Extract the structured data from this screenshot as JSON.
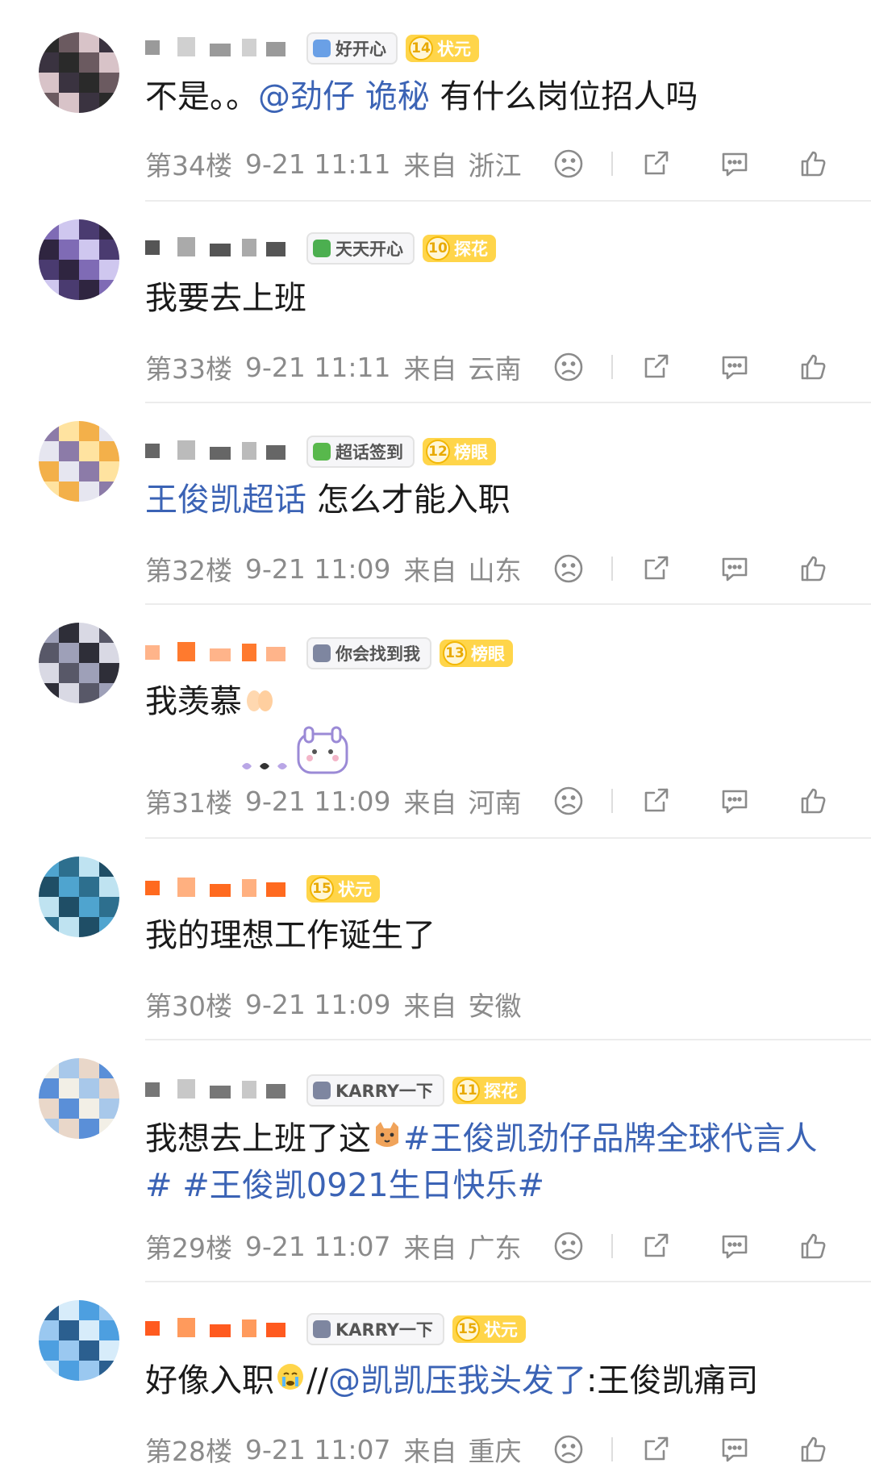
{
  "comments": [
    {
      "badge": "好开心",
      "badge_color": "#6aa0e6",
      "level_num": "14",
      "level_text": "状元",
      "content_parts": [
        {
          "t": "不是。。",
          "link": false
        },
        {
          "t": "@劲仔",
          "link": true
        },
        {
          "t": " ",
          "link": false
        },
        {
          "t": "诡秘",
          "link": true
        },
        {
          "t": " 有什么岗位招人吗",
          "link": false
        }
      ],
      "floor": "第34楼",
      "time": "9-21 11:11",
      "from": "来自",
      "region": "浙江"
    },
    {
      "badge": "天天开心",
      "badge_color": "#4caf50",
      "level_num": "10",
      "level_text": "探花",
      "content_parts": [
        {
          "t": "我要去上班",
          "link": false
        }
      ],
      "floor": "第33楼",
      "time": "9-21 11:11",
      "from": "来自",
      "region": "云南"
    },
    {
      "badge": "超话签到",
      "badge_color": "#58b84c",
      "level_num": "12",
      "level_text": "榜眼",
      "content_parts": [
        {
          "t": "王俊凯超话",
          "link": true
        },
        {
          "t": " 怎么才能入职",
          "link": false
        }
      ],
      "floor": "第32楼",
      "time": "9-21 11:09",
      "from": "来自",
      "region": "山东"
    },
    {
      "badge": "你会找到我",
      "badge_color": "#7e86a0",
      "level_num": "13",
      "level_text": "榜眼",
      "content_parts": [
        {
          "t": "我羡慕",
          "link": false
        }
      ],
      "floor": "第31楼",
      "time": "9-21 11:09",
      "from": "来自",
      "region": "河南"
    },
    {
      "badge": "",
      "badge_color": "",
      "level_num": "15",
      "level_text": "状元",
      "content_parts": [
        {
          "t": "我的理想工作诞生了",
          "link": false
        }
      ],
      "floor": "第30楼",
      "time": "9-21 11:09",
      "from": "来自",
      "region": "安徽"
    },
    {
      "badge": "KARRY一下",
      "badge_color": "#7e86a0",
      "level_num": "11",
      "level_text": "探花",
      "content_parts": [
        {
          "t": "我想去上班了这",
          "link": false
        },
        {
          "t": "#王俊凯劲仔品牌全球代言人#",
          "link": true
        },
        {
          "t": " ",
          "link": false
        },
        {
          "t": "#王俊凯0921生日快乐#",
          "link": true
        }
      ],
      "floor": "第29楼",
      "time": "9-21 11:07",
      "from": "来自",
      "region": "广东"
    },
    {
      "badge": "KARRY一下",
      "badge_color": "#7e86a0",
      "level_num": "15",
      "level_text": "状元",
      "content_parts": [
        {
          "t": "好像入职",
          "link": false
        },
        {
          "t": "//",
          "link": false
        },
        {
          "t": "@凯凯压我头发了",
          "link": true
        },
        {
          "t": ":王俊凯痛司",
          "link": false
        }
      ],
      "floor": "第28楼",
      "time": "9-21 11:07",
      "from": "来自",
      "region": "重庆"
    }
  ],
  "colors": {
    "link": "#3b63b5",
    "meta": "#8b8b8b",
    "level_badge": "#ffd54a"
  }
}
